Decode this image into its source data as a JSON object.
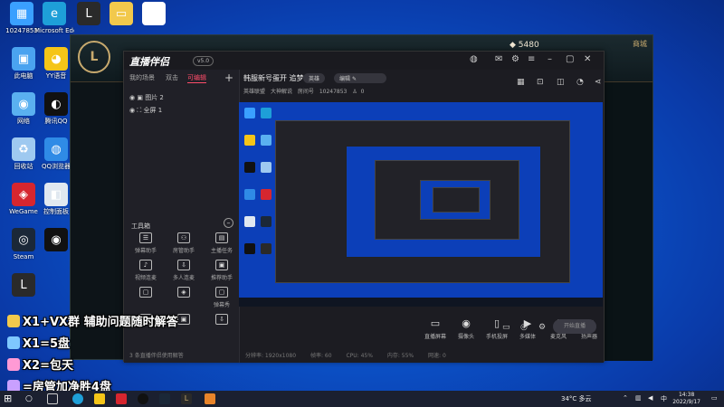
{
  "desktop": {
    "icons": [
      {
        "label": "10247853",
        "color": "#3aa0ff",
        "glyph": "▦"
      },
      {
        "label": "Microsoft Edge",
        "color": "#1e9fd8",
        "glyph": "e"
      },
      {
        "label": "",
        "color": "#2a2a2a",
        "glyph": "L"
      },
      {
        "label": "",
        "color": "#f2c94c",
        "glyph": "▭"
      },
      {
        "label": "",
        "color": "#ffffff",
        "glyph": "▯"
      },
      {
        "label": "此电脑",
        "color": "#4aa3f0",
        "glyph": "▣"
      },
      {
        "label": "YY语音",
        "color": "#f5c518",
        "glyph": "◕"
      },
      {
        "label": "网络",
        "color": "#5ab0f0",
        "glyph": "◉"
      },
      {
        "label": "腾讯QQ",
        "color": "#111111",
        "glyph": "◐"
      },
      {
        "label": "回收站",
        "color": "#9ec9f0",
        "glyph": "♻"
      },
      {
        "label": "QQ浏览器",
        "color": "#2f8be6",
        "glyph": "◍"
      },
      {
        "label": "WeGame",
        "color": "#d6262f",
        "glyph": "◈"
      },
      {
        "label": "控制面板",
        "color": "#e0e8f0",
        "glyph": "◧"
      },
      {
        "label": "Steam",
        "color": "#1b2838",
        "glyph": "◎"
      },
      {
        "label": "",
        "color": "#111111",
        "glyph": "◉"
      },
      {
        "label": "",
        "color": "#2a2a2a",
        "glyph": "L"
      }
    ]
  },
  "game": {
    "coins": "5480",
    "shop_label": "商城"
  },
  "app": {
    "logo": "直播伴侣",
    "version": "v5.0",
    "tabs": [
      "我的场景",
      "双击",
      "可编辑"
    ],
    "sources": [
      "图片 2",
      "全屏 1"
    ],
    "tools_title": "工具箱",
    "tools": [
      {
        "label": "弹幕助手",
        "glyph": "☰"
      },
      {
        "label": "房管助手",
        "glyph": "⚇"
      },
      {
        "label": "主播任务",
        "glyph": "▤"
      },
      {
        "label": "视频连麦",
        "glyph": "♪"
      },
      {
        "label": "多人连麦",
        "glyph": "⇩"
      },
      {
        "label": "推荐助手",
        "glyph": "▣"
      },
      {
        "label": "",
        "glyph": "▢"
      },
      {
        "label": "",
        "glyph": "◈"
      },
      {
        "label": "弹幕秀",
        "glyph": "▢"
      },
      {
        "label": "",
        "glyph": "▤"
      },
      {
        "label": "",
        "glyph": "▣"
      },
      {
        "label": "",
        "glyph": "⇩"
      }
    ],
    "left_footer": "3 条直播伴侣使用解答",
    "stream_title": "韩服新号蛋开 追梦",
    "category_pill": "英雄",
    "edit_pill": "编辑",
    "meta": [
      "英雄联盟",
      "大神解说",
      "房间号",
      "10247853"
    ],
    "viewers": "0",
    "bottom_buttons": [
      {
        "label": "直播屏幕",
        "glyph": "▭"
      },
      {
        "label": "摄像头",
        "glyph": "◉"
      },
      {
        "label": "手机投屏",
        "glyph": "▯"
      },
      {
        "label": "多媒体",
        "glyph": "▶"
      },
      {
        "label": "麦克风",
        "glyph": "♪"
      },
      {
        "label": "扬声器",
        "glyph": "◀"
      }
    ],
    "live_button": "开始直播",
    "status": [
      "分辨率: 1920x1080",
      "帧率: 60",
      "CPU: 45%",
      "内存: 55%",
      "网速: 0"
    ]
  },
  "overlay": [
    {
      "text": "X1+VX群 辅助问题随时解答",
      "color": "#f2c94c"
    },
    {
      "text": "X1=5盘",
      "color": "#7ec8ff"
    },
    {
      "text": "X2=包天",
      "color": "#ff9ad5"
    },
    {
      "text": "=房管加净胜4盘",
      "color": "#c9a0ff"
    }
  ],
  "taskbar": {
    "temperature": "34°C 多云",
    "time": "14:38",
    "date": "2022/9/17",
    "lang": "中"
  }
}
